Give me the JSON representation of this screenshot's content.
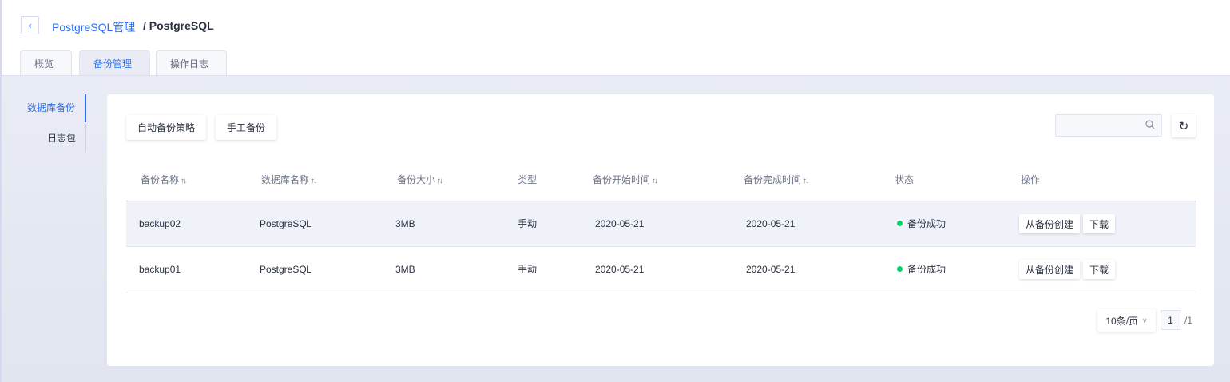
{
  "breadcrumb": {
    "parent": "PostgreSQL管理",
    "current": "/ PostgreSQL"
  },
  "tabs": [
    {
      "label": "概览"
    },
    {
      "label": "备份管理"
    },
    {
      "label": "操作日志"
    }
  ],
  "sidebar": [
    {
      "label": "数据库备份"
    },
    {
      "label": "日志包"
    }
  ],
  "toolbar": {
    "auto_policy": "自动备份策略",
    "manual_backup": "手工备份",
    "search_placeholder": ""
  },
  "table": {
    "columns": [
      "备份名称",
      "数据库名称",
      "备份大小",
      "类型",
      "备份开始时间",
      "备份完成时间",
      "状态",
      "操作"
    ],
    "sort_glyph": "↑↓",
    "rows": [
      {
        "name": "backup02",
        "db": "PostgreSQL",
        "size": "3MB",
        "type": "手动",
        "start": "2020-05-21",
        "end": "2020-05-21",
        "status": "备份成功"
      },
      {
        "name": "backup01",
        "db": "PostgreSQL",
        "size": "3MB",
        "type": "手动",
        "start": "2020-05-21",
        "end": "2020-05-21",
        "status": "备份成功"
      }
    ],
    "actions": {
      "create": "从备份创建",
      "download": "下载"
    }
  },
  "pagination": {
    "page_size": "10条/页",
    "page": "1",
    "total": "/1"
  },
  "colors": {
    "accent": "#2f6fed",
    "success": "#00d26a"
  }
}
